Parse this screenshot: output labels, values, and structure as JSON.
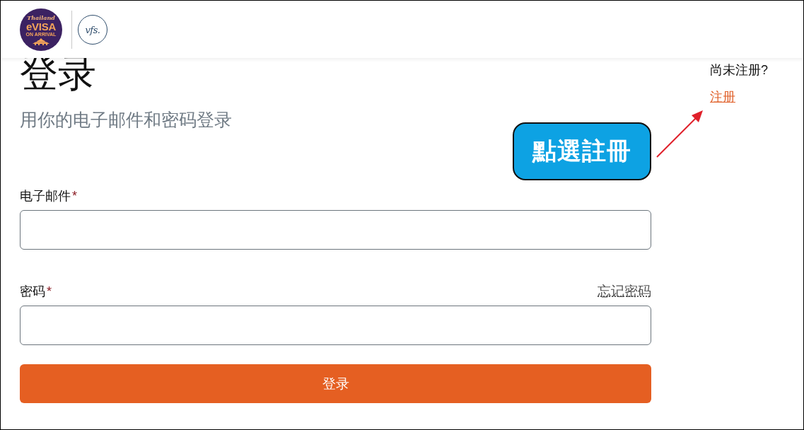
{
  "header": {
    "logo": {
      "script": "Thailand",
      "title": "eVISA",
      "subtitle": "ON ARRIVAL"
    },
    "partner_logo": {
      "text": "vfs."
    }
  },
  "login": {
    "title": "登录",
    "subtitle": "用你的电子邮件和密码登录",
    "fields": [
      {
        "label": "电子邮件",
        "required_mark": "*"
      },
      {
        "label": "密码",
        "required_mark": "*",
        "link": "忘记密码"
      }
    ],
    "submit": "登录"
  },
  "signup": {
    "prompt": "尚未注册?",
    "link": "注册"
  },
  "annotation": {
    "callout": "點選註冊"
  }
}
